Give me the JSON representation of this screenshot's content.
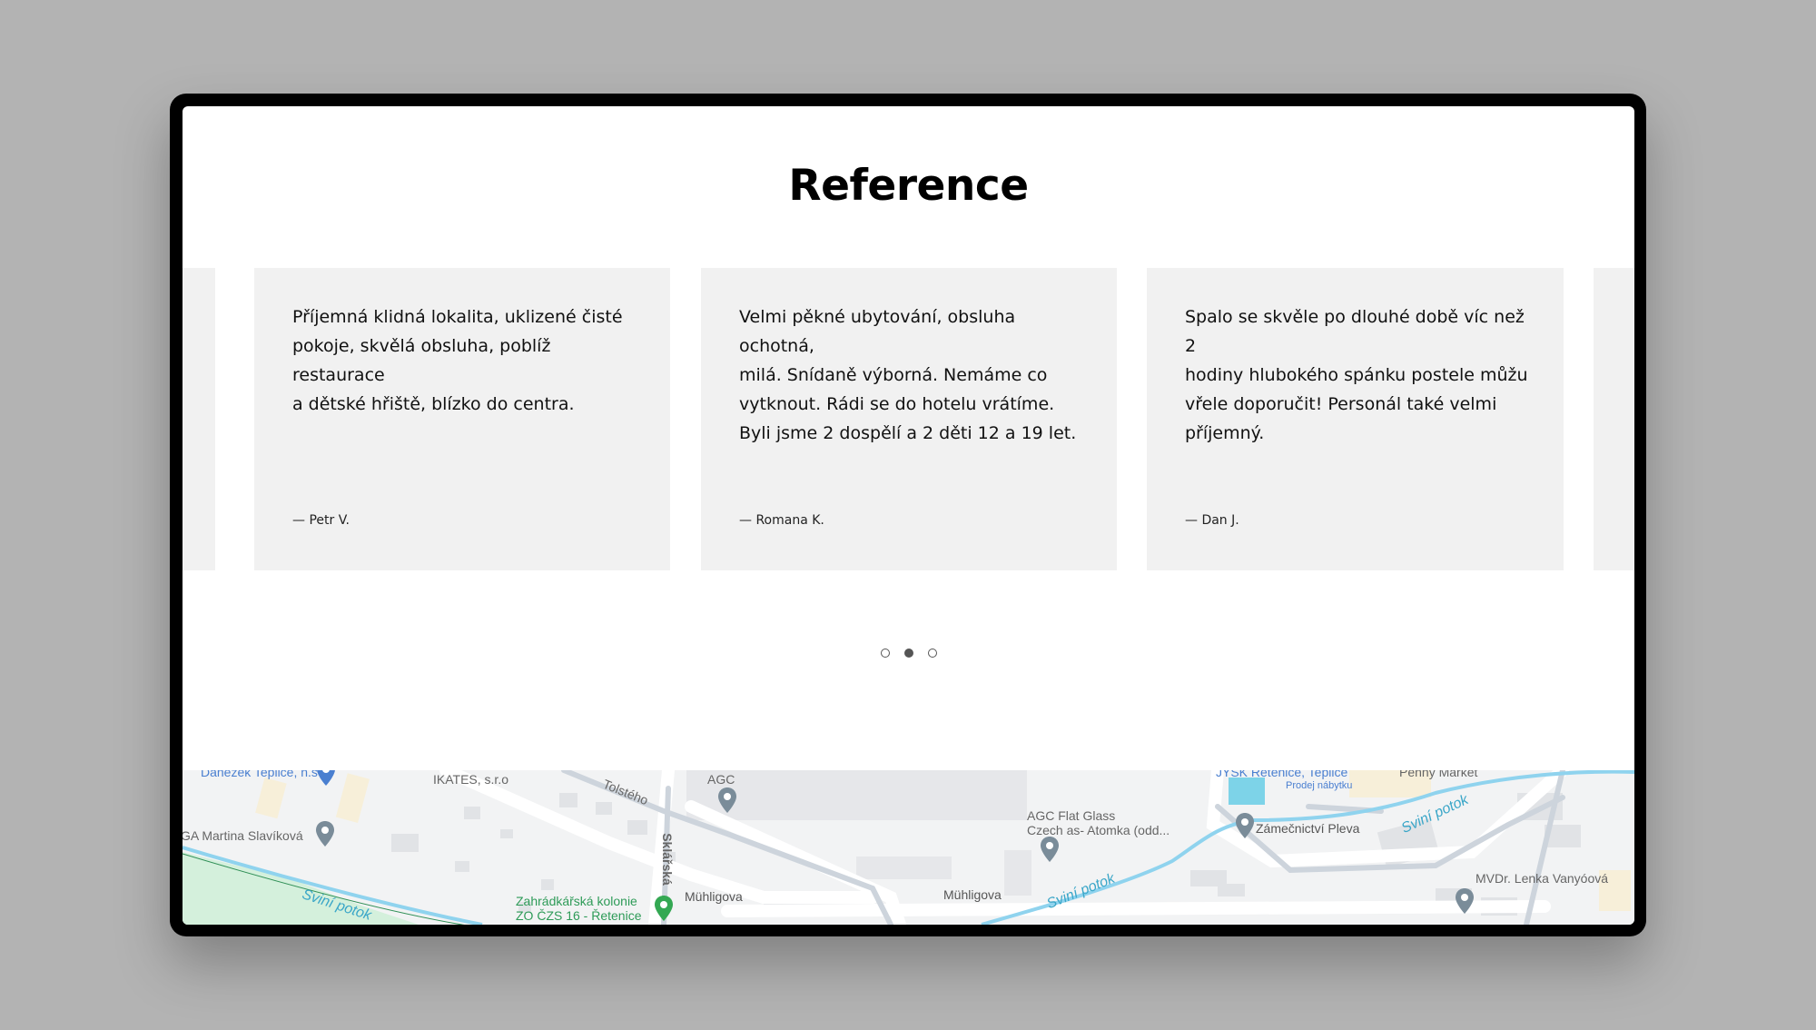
{
  "section": {
    "title": "Reference"
  },
  "testimonials": [
    {
      "text": "Příjemná klidná lokalita, uklizené čisté\npokoje, skvělá obsluha, poblíž restaurace\na dětské hřiště, blízko do centra.",
      "author": "— Petr V."
    },
    {
      "text": "Velmi pěkné ubytování, obsluha ochotná,\nmilá. Snídaně výborná. Nemáme co\nvytknout. Rádi se do hotelu vrátíme.\nByli jsme 2 dospělí a 2 děti 12 a 19 let.",
      "author": "— Romana K."
    },
    {
      "text": "Spalo se skvěle po dlouhé době víc než 2\nhodiny hlubokého spánku postele můžu\nvřele doporučit! Personál také velmi\npříjemný.",
      "author": "— Dan J."
    }
  ],
  "pagination": {
    "count": 3,
    "active_index": 1
  },
  "map": {
    "labels": {
      "danezek": "Danezek Teplice, h.s",
      "ikates": "IKATES, s.r.o",
      "tolsteho": "Tolstého",
      "agc": "AGC",
      "agc_flat_line1": "AGC Flat Glass",
      "agc_flat_line2": "Czech as- Atomka (odd...",
      "jysk": "JYSK Retenice, Teplice",
      "jysk_sub": "Prodej nábytku",
      "penny": "Penny Market",
      "martina": "GA Martina Slavíková",
      "sklarska": "Sklářská",
      "zamecnictvi": "Zámečnictví Pleva",
      "svini1": "Sviní potok",
      "svini2": "Sviní potok",
      "svini3": "Sviní potok",
      "muhligova1": "Mühligova",
      "muhligova2": "Mühligova",
      "mvdr": "MVDr. Lenka Vanyóová",
      "zahradkarska_line1": "Zahrádkářská kolonie",
      "zahradkarska_line2": "ZO ČZS 16 - Řetenice"
    }
  }
}
